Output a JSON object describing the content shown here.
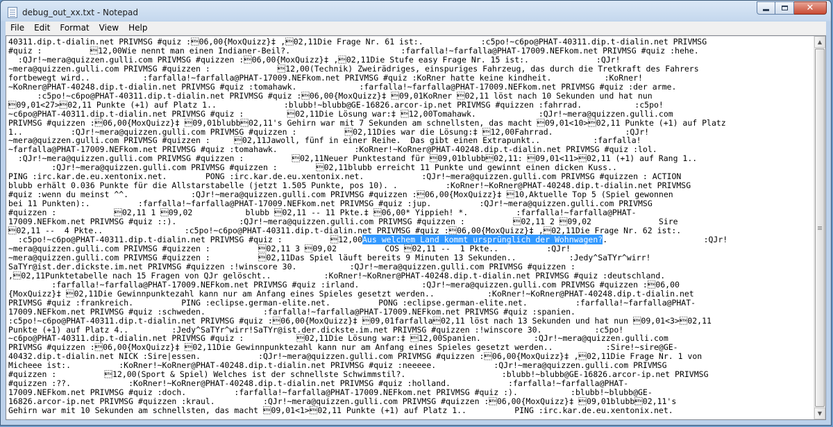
{
  "window": {
    "title": "debug_out_xx.txt - Notepad"
  },
  "menu": [
    "File",
    "Edit",
    "Format",
    "View",
    "Help"
  ],
  "controls": {
    "minimize": "minimize",
    "maximize": "maximize",
    "close": "close"
  },
  "document": {
    "lines": [
      "40311.dip.t-dialin.net PRIVMSG #quiz :\u000306,00{MoxQuizz}‡ ,\u000302,11Die Frage Nr. 61 ist:.            :c5po!~c6po@PHAT-40311.dip.t-dialin.net PRIVMSG",
      "#quiz :          \u000312,00Wie nennt man einen Indianer-Beil?.                       :farfalla!~farfalla@PHAT-17009.NEFkom.net PRIVMSG #quiz :hehe.",
      "  :QJr!~mera@quizzen.gulli.com PRIVMSG #quizzen :\u000306,00{MoxQuizz}‡ ,\u000302,11Die Stufe easy Frage Nr. 15 ist:.              :QJr!",
      "~mera@quizzen.gulli.com PRIVMSG #quizzen :              \u000312,00(Technik) Zweirädriges, einspuriges Fahrzeug, das durch die Tretkraft des Fahrers",
      "fortbewegt wird..           :farfalla!~farfalla@PHAT-17009.NEFkom.net PRIVMSG #quiz :KoRner hatte keine kindheit.           :KoRner!",
      "~KoRner@PHAT-40248.dip.t-dialin.net PRIVMSG #quiz :tomahawk.             :farfalla!~farfalla@PHAT-17009.NEFkom.net PRIVMSG #quiz :der arme.",
      "      :c5po!~c6po@PHAT-40311.dip.t-dialin.net PRIVMSG #quiz :\u000306,00{MoxQuizz}‡ \u000309,01KoRner \u000302,11 löst nach 10 Sekunden und hat nun",
      "\u000309,01<27>\u000302,11 Punkte (+1) auf Platz 1..              :blubb!~blubb@GE-16826.arcor-ip.net PRIVMSG #quizzen :fahrrad.           :c5po!",
      "~c6po@PHAT-40311.dip.t-dialin.net PRIVMSG #quiz :         \u000302,11Die Lösung war:‡ \u000312,00Tomahawk.             :QJr!~mera@quizzen.gulli.com",
      "PRIVMSG #quizzen :\u000306,00{MoxQuizz}‡ \u000309,01blubb\u000302,11's Gehirn war mit 7 Sekunden am schnellsten, das macht \u000309,01<10>\u000302,11 Punkte (+1) auf Platz",
      "1..          :QJr!~mera@quizzen.gulli.com PRIVMSG #quizzen :          \u000302,11Dies war die Lösung:‡ \u000312,00Fahrrad.               :QJr!",
      "~mera@quizzen.gulli.com PRIVMSG #quizzen :     \u000302,11Jawoll, fünf in einer Reihe.  Das gibt einen Extrapunkt..           :farfalla!",
      "~farfalla@PHAT-17009.NEFkom.net PRIVMSG #quiz :tomahawk.                :KoRner!~KoRner@PHAT-40248.dip.t-dialin.net PRIVMSG #quiz :lol.",
      "  :QJr!~mera@quizzen.gulli.com PRIVMSG #quizzen :          \u000302,11Neuer Punktestand für \u000309,01blubb\u000302,11: \u000309,01<11>\u000302,11 (+1) auf Rang 1..",
      "         :QJr!~mera@quizzen.gulli.com PRIVMSG #quizzen :        \u000302,11blubb erreicht 11 Punkte und gewinnt einen dicken Kuss..",
      "PING :irc.kar.de.eu.xentonix.net.        PONG :irc.kar.de.eu.xentonix.net.            :QJr!~mera@quizzen.gulli.com PRIVMSG #quizzen : ACTION",
      "blubb erhält 0.036 Punkte für die Allstarstabelle (jetzt 1.505 Punkte, pos 10). .          :KoRner!~KoRner@PHAT-40248.dip.t-dialin.net PRIVMSG",
      "#quiz :wenn du meinst ^^.             :QJr!~mera@quizzen.gulli.com PRIVMSG #quizzen :\u000306,00{MoxQuizz}‡ \u000310,Aktuelle Top 5 (Spiel gewonnen",
      "bei 11 Punkten):.          :farfalla!~farfalla@PHAT-17009.NEFkom.net PRIVMSG #quiz :jup.          :QJr!~mera@quizzen.gulli.com PRIVMSG",
      "#quizzen :            \u000302,11 1 \u000309,02           blubb \u000302,11 -- 11 Pkte.‡ \u000306,00* Yippieh! *.          :farfalla!~farfalla@PHAT-",
      "17009.NEFkom.net PRIVMSG #quiz ::).             :QJr!~mera@quizzen.gulli.com PRIVMSG #quizzen :          \u000302,11 2 \u000309,02              Sire",
      "\u000302,11 --  4 Pkte..                 :c5po!~c6po@PHAT-40311.dip.t-dialin.net PRIVMSG #quiz :\u000306,00{MoxQuizz}‡ ,\u000302,11Die Frage Nr. 62 ist:.",
      "  :c5po!~c6po@PHAT-40311.dip.t-dialin.net PRIVMSG #quiz :          \u000312,00",
      "~mera@quizzen.gulli.com PRIVMSG #quizzen :          \u000302,11 3 \u000309,02          COS \u000302,11 --  1 Pkte..          :QJr!",
      "~mera@quizzen.gulli.com PRIVMSG #quizzen :          \u000302,11Das Spiel läuft bereits 9 Minuten 13 Sekunden..           :Jedy^SaTYr^wirr!",
      "SaTYr@ist.der.dickste.im.net PRIVMSG #quizzen :!winscore 30.           :QJr!~mera@quizzen.gulli.com PRIVMSG #quizzen :",
      ",\u000302,11Punktetabelle nach 15 Fragen von QJr gelöscht..           :KoRner!~KoRner@PHAT-40248.dip.t-dialin.net PRIVMSG #quiz :deutschland.",
      "         :farfalla!~farfalla@PHAT-17009.NEFkom.net PRIVMSG #quiz :irland.             :QJr!~mera@quizzen.gulli.com PRIVMSG #quizzen :\u000306,00",
      "{MoxQuizz}‡ \u000302,11Die Gewinnpunktezahl kann nur am Anfang eines Spieles gesetzt werden..           :KoRner!~KoRner@PHAT-40248.dip.t-dialin.net",
      "PRIVMSG #quiz :frankreich.          PING :eclipse.german-elite.net.          PONG :eclipse.german-elite.net.          :farfalla!~farfalla@PHAT-",
      "17009.NEFkom.net PRIVMSG #quiz :schweden.            :farfalla!~farfalla@PHAT-17009.NEFkom.net PRIVMSG #quiz :spanien.",
      ":c5po!~c6po@PHAT-40311.dip.t-dialin.net PRIVMSG #quiz :\u000306,00{MoxQuizz}‡ \u000309,01farfalla\u000302,11 löst nach 13 Sekunden und hat nun \u000309,01<3>\u000302,11",
      "Punkte (+1) auf Platz 4..         :Jedy^SaTYr^wirr!SaTYr@ist.der.dickste.im.net PRIVMSG #quizzen :!winscore 30.           :c5po!",
      "~c6po@PHAT-40311.dip.t-dialin.net PRIVMSG #quiz :           \u000302,11Die Lösung war:‡ \u000312,00Spanien.           :QJr!~mera@quizzen.gulli.com",
      "PRIVMSG #quizzen :\u000306,00{MoxQuizz}‡ \u000302,11Die Gewinnpunktezahl kann nur am Anfang eines Spieles gesetzt werden..           :Sire!~sire@GE-",
      "40432.dip.t-dialin.net NICK :Sire|essen.            :QJr!~mera@quizzen.gulli.com PRIVMSG #quizzen :\u000306,00{MoxQuizz}‡ ,\u000302,11Die Frage Nr. 1 von",
      "Micheee ist:.          :KoRner!~KoRner@PHAT-40248.dip.t-dialin.net PRIVMSG #quiz :neeeee.            :QJr!~mera@quizzen.gulli.com PRIVMSG",
      "#quizzen :          \u000312,00(Sport & Spiel) Welches ist der schnellste Schwimmstil?.                    :blubb!~blubb@GE-16826.arcor-ip.net PRIVMSG",
      "#quizzen :??.            :KoRner!~KoRner@PHAT-40248.dip.t-dialin.net PRIVMSG #quiz :holland.            :farfalla!~farfalla@PHAT-",
      "17009.NEFkom.net PRIVMSG #quiz :doch.          :farfalla!~farfalla@PHAT-17009.NEFkom.net PRIVMSG #quiz :).           :blubb!~blubb@GE-",
      "16826.arcor-ip.net PRIVMSG #quizzen :kraul.          :QJr!~mera@quizzen.gulli.com PRIVMSG #quizzen :\u000306,00{MoxQuizz}‡ \u000309,01blubb\u000302,11's",
      "Gehirn war mit 10 Sekunden am schnellsten, das macht \u000309,01<1>\u000302,11 Punkte (+1) auf Platz 1..          PING :irc.kar.de.eu.xentonix.net."
    ],
    "selection_line_index": 22,
    "selected_text": "Aus welchem Land kommt ursprünglich der Wohnwagen?",
    "after_selection": ".                    :QJr!"
  }
}
